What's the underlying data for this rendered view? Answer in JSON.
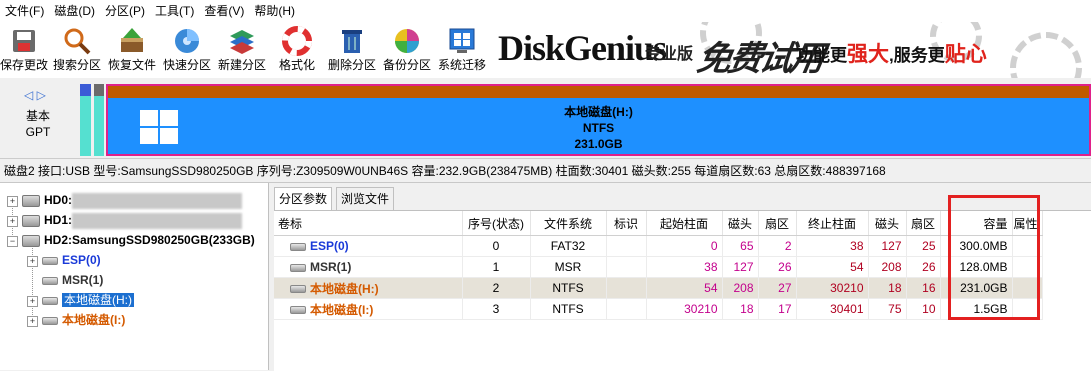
{
  "menu": [
    "文件(F)",
    "磁盘(D)",
    "分区(P)",
    "工具(T)",
    "查看(V)",
    "帮助(H)"
  ],
  "toolbar": [
    {
      "label": "保存更改",
      "icon": "save-icon"
    },
    {
      "label": "搜索分区",
      "icon": "magnifier-icon"
    },
    {
      "label": "恢复文件",
      "icon": "recover-box-icon"
    },
    {
      "label": "快速分区",
      "icon": "disk-quick-icon"
    },
    {
      "label": "新建分区",
      "icon": "layers-icon"
    },
    {
      "label": "格式化",
      "icon": "lifebuoy-icon"
    },
    {
      "label": "删除分区",
      "icon": "trash-icon"
    },
    {
      "label": "备份分区",
      "icon": "pie-backup-icon"
    },
    {
      "label": "系统迁移",
      "icon": "windows-migrate-icon"
    }
  ],
  "banner": {
    "logo": "DiskGenius",
    "edition": "专业版",
    "promo": "免费试用",
    "slogan_a": "功能更",
    "slogan_b": "强大",
    "slogan_c": ",服务更",
    "slogan_d": "贴心"
  },
  "diskmap": {
    "type_line1": "基本",
    "type_line2": "GPT",
    "partition_name": "本地磁盘(H:)",
    "partition_fs": "NTFS",
    "partition_size": "231.0GB"
  },
  "infobar": "磁盘2 接口:USB  型号:SamsungSSD980250GB  序列号:Z309509W0UNB46S  容量:232.9GB(238475MB)  柱面数:30401  磁头数:255  每道扇区数:63  总扇区数:488397168",
  "tree": {
    "hd0": "HD0:",
    "hd1": "HD1:",
    "hd2": "HD2:SamsungSSD980250GB(233GB)",
    "parts": [
      "ESP(0)",
      "MSR(1)",
      "本地磁盘(H:)",
      "本地磁盘(I:)"
    ]
  },
  "tabs": [
    "分区参数",
    "浏览文件"
  ],
  "table": {
    "headers": [
      "卷标",
      "序号(状态)",
      "文件系统",
      "标识",
      "起始柱面",
      "磁头",
      "扇区",
      "终止柱面",
      "磁头",
      "扇区",
      "容量",
      "属性"
    ],
    "rows": [
      {
        "label": "ESP(0)",
        "idx": "0",
        "fs": "FAT32",
        "flag": "",
        "sc": "0",
        "sh": "65",
        "ss": "2",
        "ec": "38",
        "eh": "127",
        "es": "25",
        "cap": "300.0MB",
        "attr": ""
      },
      {
        "label": "MSR(1)",
        "idx": "1",
        "fs": "MSR",
        "flag": "",
        "sc": "38",
        "sh": "127",
        "ss": "26",
        "ec": "54",
        "eh": "208",
        "es": "26",
        "cap": "128.0MB",
        "attr": ""
      },
      {
        "label": "本地磁盘(H:)",
        "idx": "2",
        "fs": "NTFS",
        "flag": "",
        "sc": "54",
        "sh": "208",
        "ss": "27",
        "ec": "30210",
        "eh": "18",
        "es": "16",
        "cap": "231.0GB",
        "attr": ""
      },
      {
        "label": "本地磁盘(I:)",
        "idx": "3",
        "fs": "NTFS",
        "flag": "",
        "sc": "30210",
        "sh": "18",
        "ss": "17",
        "ec": "30401",
        "eh": "75",
        "es": "10",
        "cap": "1.5GB",
        "attr": ""
      }
    ]
  },
  "colors": {
    "accent": "#1e90ff",
    "selection": "#1c6fd0",
    "highlight_box": "#e32020",
    "partition_orange": "#c05a00"
  }
}
